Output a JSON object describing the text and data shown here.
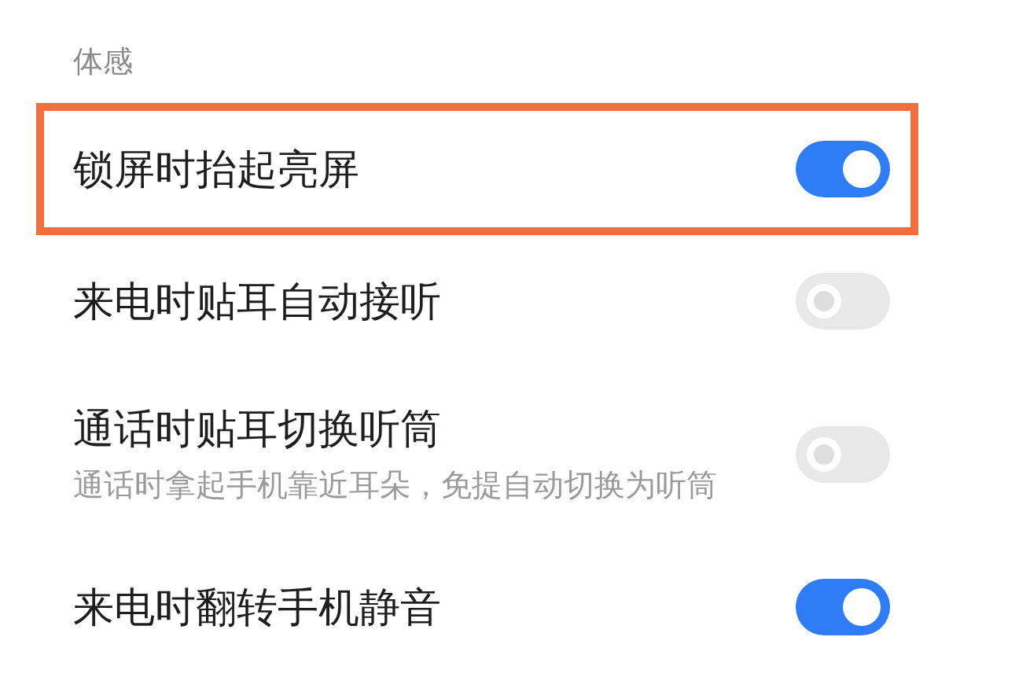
{
  "section": {
    "title": "体感"
  },
  "rows": [
    {
      "title": "锁屏时抬起亮屏",
      "on": true,
      "highlighted": true
    },
    {
      "title": "来电时贴耳自动接听",
      "on": false,
      "highlighted": false
    },
    {
      "title": "通话时贴耳切换听筒",
      "subtitle": "通话时拿起手机靠近耳朵，免提自动切换为听筒",
      "on": false,
      "highlighted": false
    },
    {
      "title": "来电时翻转手机静音",
      "on": true,
      "highlighted": false
    }
  ]
}
